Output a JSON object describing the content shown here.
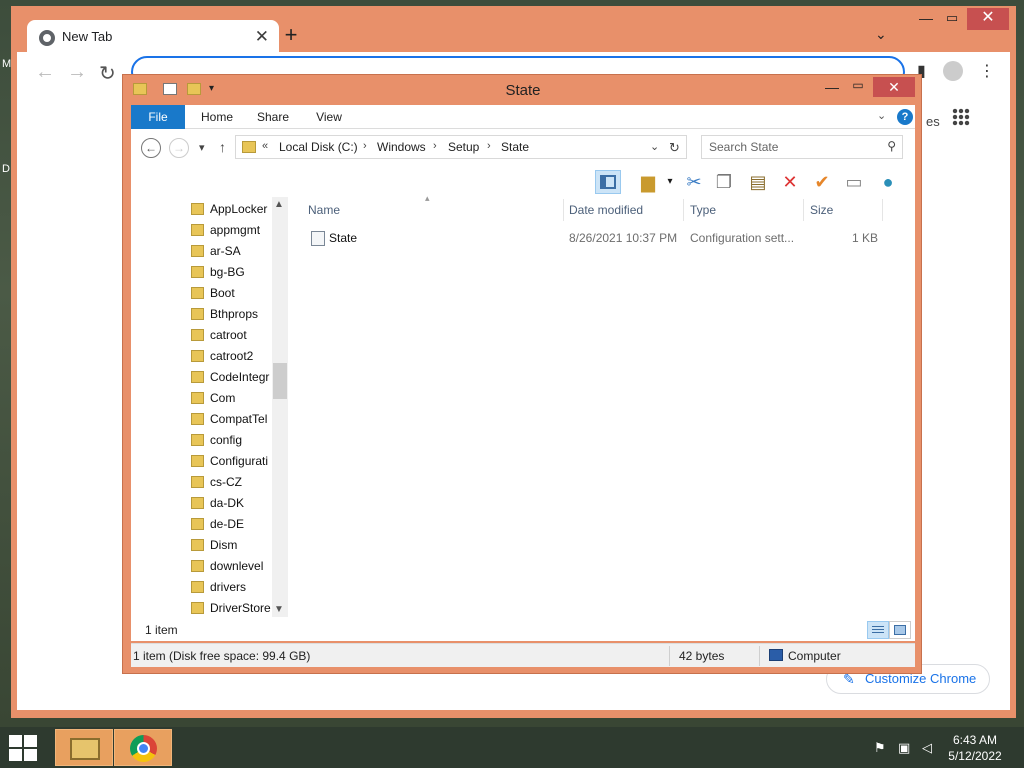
{
  "chrome": {
    "tab_title": "New Tab",
    "tab_close": "✕",
    "new_tab": "+",
    "tab_search": "⌄",
    "win_min": "—",
    "win_max": "▭",
    "win_close": "✕",
    "customize_label": "Customize Chrome",
    "partial_text": "es"
  },
  "explorer": {
    "title": "State",
    "ribbon_tabs": [
      "File",
      "Home",
      "Share",
      "View"
    ],
    "breadcrumb_prefix": "«",
    "breadcrumb": [
      "Local Disk (C:)",
      "Windows",
      "Setup",
      "State"
    ],
    "search_placeholder": "Search State",
    "tree": [
      "AppLocker",
      "appmgmt",
      "ar-SA",
      "bg-BG",
      "Boot",
      "Bthprops",
      "catroot",
      "catroot2",
      "CodeIntegr",
      "Com",
      "CompatTel",
      "config",
      "Configurati",
      "cs-CZ",
      "da-DK",
      "de-DE",
      "Dism",
      "downlevel",
      "drivers",
      "DriverStore"
    ],
    "columns": {
      "name": "Name",
      "date": "Date modified",
      "type": "Type",
      "size": "Size"
    },
    "files": [
      {
        "name": "State",
        "date": "8/26/2021 10:37 PM",
        "type": "Configuration sett...",
        "size": "1 KB"
      }
    ],
    "item_count": "1 item",
    "status_left": "1 item (Disk free space: 99.4 GB)",
    "status_size": "42 bytes",
    "status_location": "Computer"
  },
  "desktop": {
    "left_letters": [
      "M",
      "D"
    ]
  },
  "taskbar": {
    "time": "6:43 AM",
    "date": "5/12/2022"
  },
  "colors": {
    "window_frame": "#e8906a",
    "file_tab": "#1979ca",
    "close_button": "#c75050",
    "taskbar": "#2e3a2f"
  }
}
